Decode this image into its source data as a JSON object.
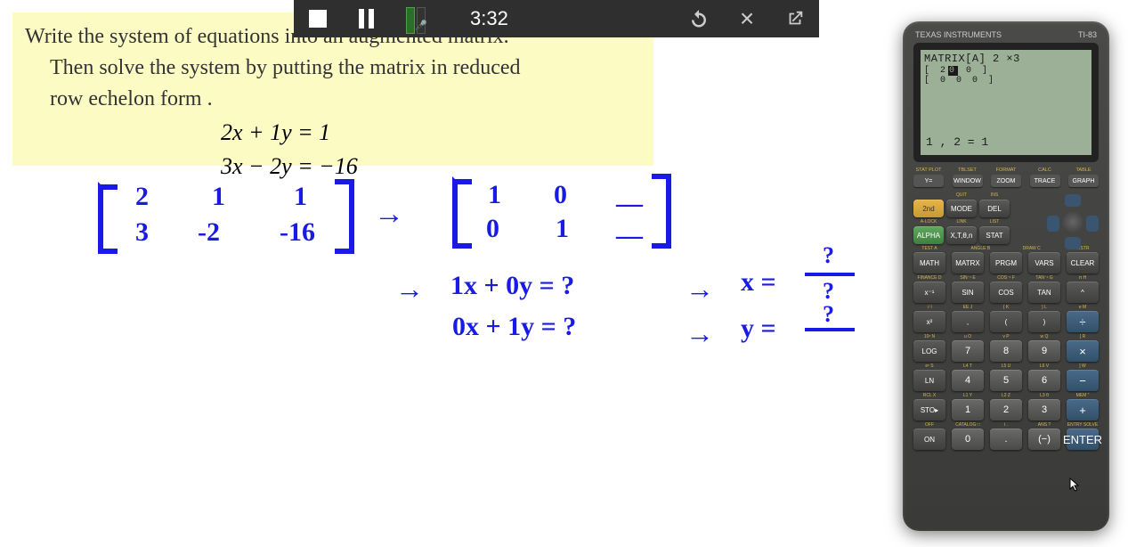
{
  "problem": {
    "line1": "Write the system of equations into an augmented matrix.",
    "line2": "Then solve the system by putting the matrix in reduced",
    "line3": "row echelon form .",
    "eq1": "2x + 1y = 1",
    "eq2": "3x − 2y = −16"
  },
  "video_controls": {
    "time": "3:32"
  },
  "handwritten": {
    "m1_r1c1": "2",
    "m1_r1c2": "1",
    "m1_r1c3": "1",
    "m1_r2c1": "3",
    "m1_r2c2": "-2",
    "m1_r2c3": "-16",
    "arrow": "→",
    "m2_r1c1": "1",
    "m2_r1c2": "0",
    "m2_r1c3": "—",
    "m2_r2c1": "0",
    "m2_r2c2": "1",
    "m2_r2c3": "—",
    "line1": "1x  + 0y = ?",
    "line2": "0x + 1y = ?",
    "res1": "x =",
    "res2": "y =",
    "frac_q": "?"
  },
  "calculator": {
    "brand_left": "TEXAS INSTRUMENTS",
    "brand_right": "TI-83",
    "screen": {
      "line1": "MATRIX[A] 2 ×3",
      "row1_open": "[ 2",
      "row1_hl": "0",
      "row1_rest": "        0       ]",
      "row2": "[ 0       0        0       ]",
      "bottom": "1 , 2 = 1"
    },
    "fn_labels": [
      "STAT PLOT",
      "TBLSET",
      "FORMAT",
      "CALC",
      "TABLE"
    ],
    "top_buttons": [
      "Y=",
      "WINDOW",
      "ZOOM",
      "TRACE",
      "GRAPH"
    ],
    "side_labels_r1": [
      "",
      "QUIT",
      "INS"
    ],
    "row1": [
      "2nd",
      "MODE",
      "DEL"
    ],
    "side_labels_r2": [
      "A-LOCK",
      "LINK",
      "LIST"
    ],
    "row2": [
      "ALPHA",
      "X,T,θ,n",
      "STAT"
    ],
    "side_labels_r3": [
      "TEST  A",
      "ANGLE B",
      "DRAW C",
      "DISTR"
    ],
    "row3": [
      "MATH",
      "MATRX",
      "PRGM",
      "VARS",
      "CLEAR"
    ],
    "side_labels_r4": [
      "FINANCE D",
      "SIN⁻¹ E",
      "COS⁻¹ F",
      "TAN⁻¹ G",
      "π  H"
    ],
    "row4": [
      "x⁻¹",
      "SIN",
      "COS",
      "TAN",
      "^"
    ],
    "side_labels_r5": [
      "√  I",
      "EE  J",
      "{  K",
      "}  L",
      "e  M"
    ],
    "row5": [
      "x²",
      ",",
      "(",
      ")",
      "÷"
    ],
    "side_labels_r6": [
      "10ˣ  N",
      "u  O",
      "v  P",
      "w  Q",
      "[  R"
    ],
    "row6": [
      "LOG",
      "7",
      "8",
      "9",
      "×"
    ],
    "side_labels_r7": [
      "eˣ  S",
      "L4  T",
      "L5  U",
      "L6  V",
      "]  W"
    ],
    "row7": [
      "LN",
      "4",
      "5",
      "6",
      "−"
    ],
    "side_labels_r8": [
      "RCL  X",
      "L1  Y",
      "L2  Z",
      "L3  θ",
      "MEM  \""
    ],
    "row8": [
      "STO▸",
      "1",
      "2",
      "3",
      "+"
    ],
    "side_labels_r9": [
      "OFF",
      "CATALOG □",
      "i  .",
      "ANS  ?",
      "ENTRY SOLVE"
    ],
    "row9": [
      "ON",
      "0",
      ".",
      "(−)",
      "ENTER"
    ]
  }
}
